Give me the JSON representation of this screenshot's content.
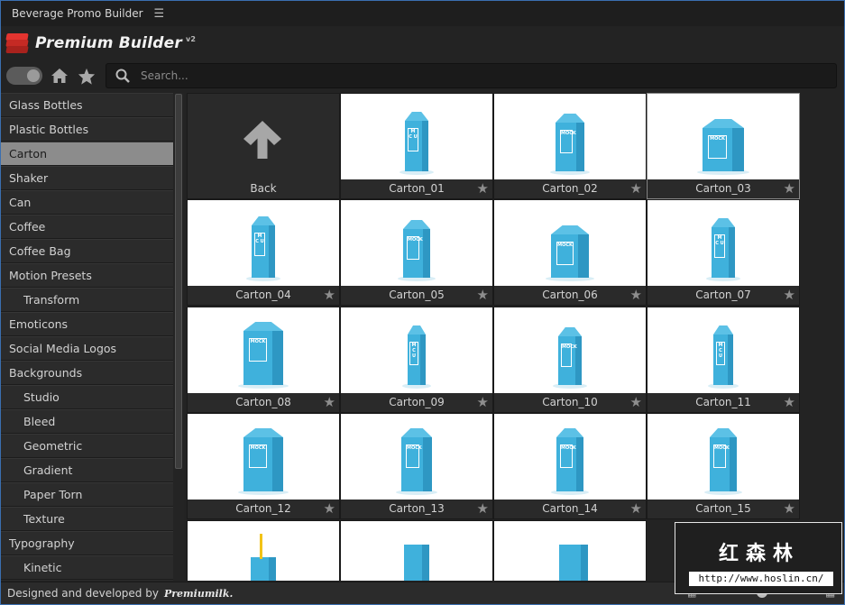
{
  "window": {
    "title": "Beverage Promo Builder",
    "menu_icon": "hamburger-icon"
  },
  "header": {
    "brand": "Premium Builder",
    "version": "v2"
  },
  "toolbar": {
    "search_placeholder": "Search..."
  },
  "sidebar": {
    "items": [
      {
        "label": "Glass Bottles",
        "sub": false
      },
      {
        "label": "Plastic Bottles",
        "sub": false
      },
      {
        "label": "Carton",
        "sub": false,
        "active": true
      },
      {
        "label": "Shaker",
        "sub": false
      },
      {
        "label": "Can",
        "sub": false
      },
      {
        "label": "Coffee",
        "sub": false
      },
      {
        "label": "Coffee Bag",
        "sub": false
      },
      {
        "label": "Motion Presets",
        "sub": false
      },
      {
        "label": "Transform",
        "sub": true
      },
      {
        "label": "Emoticons",
        "sub": false
      },
      {
        "label": "Social Media Logos",
        "sub": false
      },
      {
        "label": "Backgrounds",
        "sub": false
      },
      {
        "label": "Studio",
        "sub": true
      },
      {
        "label": "Bleed",
        "sub": true
      },
      {
        "label": "Geometric",
        "sub": true
      },
      {
        "label": "Gradient",
        "sub": true
      },
      {
        "label": "Paper Torn",
        "sub": true
      },
      {
        "label": "Texture",
        "sub": true
      },
      {
        "label": "Typography",
        "sub": false
      },
      {
        "label": "Kinetic",
        "sub": true
      }
    ]
  },
  "grid": {
    "back_label": "Back",
    "tiles": [
      "Carton_01",
      "Carton_02",
      "Carton_03",
      "Carton_04",
      "Carton_05",
      "Carton_06",
      "Carton_07",
      "Carton_08",
      "Carton_09",
      "Carton_10",
      "Carton_11",
      "Carton_12",
      "Carton_13",
      "Carton_14",
      "Carton_15"
    ]
  },
  "footer": {
    "credit": "Designed and developed by",
    "signature": "Premiumilk."
  },
  "watermark": {
    "title": "红森林",
    "url": "http://www.hoslin.cn/"
  },
  "colors": {
    "accent": "#e3342f",
    "carton": "#3fb1dc",
    "active_item": "#8c8c8c"
  }
}
